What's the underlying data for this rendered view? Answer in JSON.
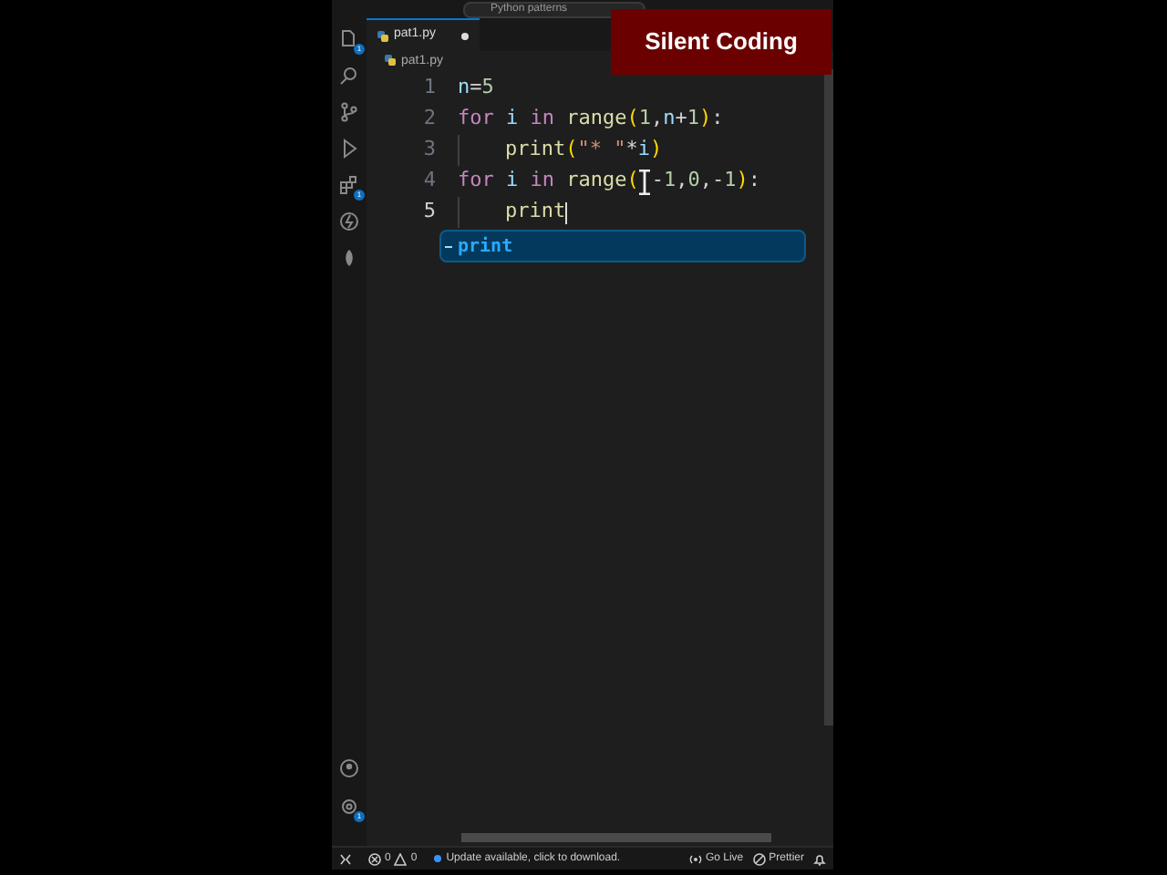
{
  "title_bar": {
    "search": "Python patterns"
  },
  "overlay": {
    "text": "Silent Coding"
  },
  "tabs": [
    {
      "label": "pat1.py",
      "selected": true,
      "modified": true
    }
  ],
  "breadcrumb": "pat1.py",
  "activity_bar": {
    "explorer_badge": "1",
    "extensions_badge": "1",
    "settings_badge": "1"
  },
  "code_lines": [
    {
      "number": "1",
      "current": false,
      "indent": false,
      "tokens": [
        {
          "text": "n",
          "kind": "var"
        },
        {
          "text": "=",
          "kind": "op"
        },
        {
          "text": "5",
          "kind": "number"
        }
      ]
    },
    {
      "number": "2",
      "current": false,
      "indent": false,
      "tokens": [
        {
          "text": "for ",
          "kind": "keyword"
        },
        {
          "text": "i",
          "kind": "var"
        },
        {
          "text": " in ",
          "kind": "keyword"
        },
        {
          "text": "range",
          "kind": "func"
        },
        {
          "text": "(",
          "kind": "paren"
        },
        {
          "text": "1",
          "kind": "number"
        },
        {
          "text": ",",
          "kind": "op"
        },
        {
          "text": "n",
          "kind": "var"
        },
        {
          "text": "+",
          "kind": "op"
        },
        {
          "text": "1",
          "kind": "number"
        },
        {
          "text": ")",
          "kind": "paren"
        },
        {
          "text": ":",
          "kind": "op"
        }
      ]
    },
    {
      "number": "3",
      "current": false,
      "indent": true,
      "tokens": [
        {
          "text": "print",
          "kind": "func"
        },
        {
          "text": "(",
          "kind": "paren"
        },
        {
          "text": "\"* \"",
          "kind": "string"
        },
        {
          "text": "*",
          "kind": "op"
        },
        {
          "text": "i",
          "kind": "var"
        },
        {
          "text": ")",
          "kind": "paren"
        }
      ]
    },
    {
      "number": "4",
      "current": false,
      "indent": false,
      "tokens": [
        {
          "text": "for ",
          "kind": "keyword"
        },
        {
          "text": "i",
          "kind": "var"
        },
        {
          "text": " in ",
          "kind": "keyword"
        },
        {
          "text": "range",
          "kind": "func"
        },
        {
          "text": "(",
          "kind": "paren"
        },
        {
          "text": "-",
          "kind": "op",
          "hidden_before": true
        },
        {
          "text": "1",
          "kind": "number"
        },
        {
          "text": ",",
          "kind": "op"
        },
        {
          "text": "0",
          "kind": "number"
        },
        {
          "text": ",",
          "kind": "op"
        },
        {
          "text": "-",
          "kind": "op"
        },
        {
          "text": "1",
          "kind": "number"
        },
        {
          "text": ")",
          "kind": "paren"
        },
        {
          "text": ":",
          "kind": "op"
        }
      ]
    },
    {
      "number": "5",
      "current": true,
      "indent": true,
      "tokens": [
        {
          "text": "print",
          "kind": "func"
        }
      ]
    }
  ],
  "suggestion": {
    "label": "print",
    "selected": true
  },
  "status_bar": {
    "errors": "0",
    "warnings": "0",
    "message": "Update available, click to download.",
    "go_live": "Go Live",
    "prettier": "Prettier"
  }
}
